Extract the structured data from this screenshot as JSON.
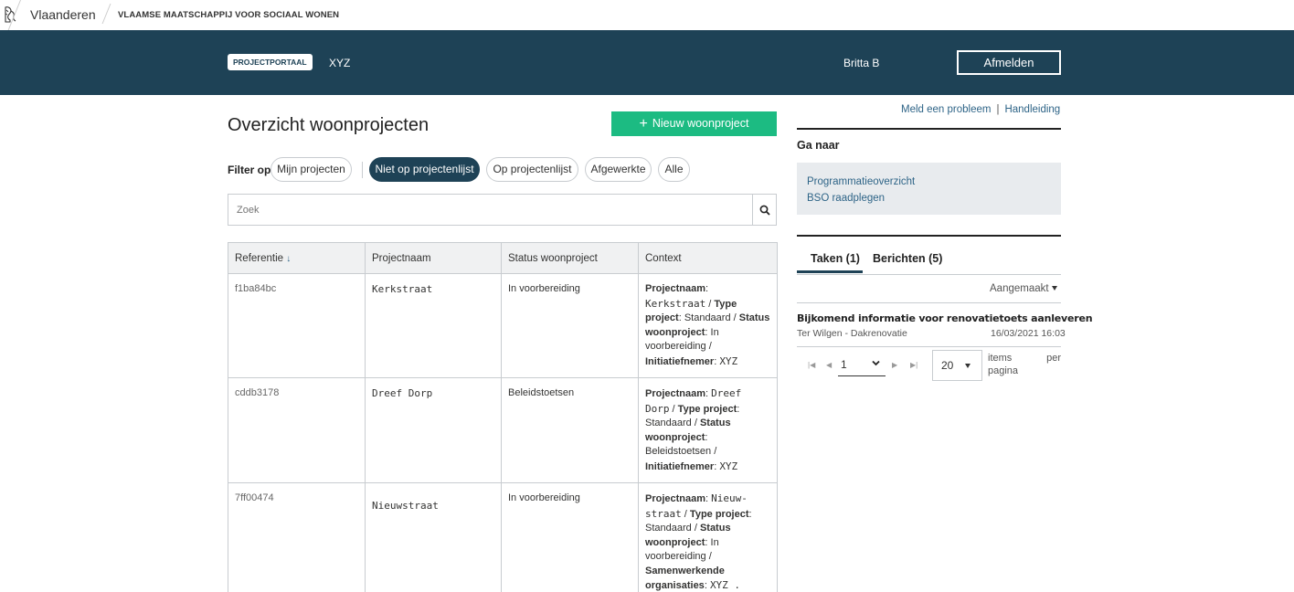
{
  "global_header": {
    "brand": "Vlaanderen",
    "organisation": "VLAAMSE MAATSCHAPPIJ VOOR SOCIAAL WONEN"
  },
  "app_header": {
    "badge": "PROJECTPORTAAL",
    "app_name": "XYZ",
    "user": "Britta B",
    "logout_label": "Afmelden"
  },
  "main": {
    "title": "Overzicht woonprojecten",
    "new_button_label": "Nieuw woonproject",
    "filter_label": "Filter op",
    "filters": [
      {
        "label": "Mijn projecten",
        "active": false
      },
      {
        "label": "Niet op projectenlijst",
        "active": true
      },
      {
        "label": "Op projectenlijst",
        "active": false
      },
      {
        "label": "Afgewerkte",
        "active": false
      },
      {
        "label": "Alle",
        "active": false
      }
    ],
    "search_placeholder": "Zoek",
    "table": {
      "headers": [
        "Referentie",
        "Projectnaam",
        "Status woonproject",
        "Context"
      ],
      "sort_indicator": "↓",
      "rows": [
        {
          "ref": "f1ba84bc",
          "name": "Kerkstraat",
          "status": "In voorbereiding",
          "context": [
            {
              "label": "Projectnaam",
              "value": "Kerkstraat",
              "mono": true
            },
            {
              "label": "Type project",
              "value": "Standaard"
            },
            {
              "label": "Status woonproject",
              "value": "In voorbereiding"
            },
            {
              "label": "Initiatiefnemer",
              "value": "XYZ",
              "mono": true
            }
          ]
        },
        {
          "ref": "cddb3178",
          "name": "Dreef Dorp",
          "status": "Beleidstoetsen",
          "context": [
            {
              "label": "Projectnaam",
              "value": "Dreef Dorp",
              "mono": true
            },
            {
              "label": "Type project",
              "value": "Standaard"
            },
            {
              "label": "Status woonproject",
              "value": "Beleidstoetsen"
            },
            {
              "label": "Initiatiefnemer",
              "value": "XYZ",
              "mono": true
            }
          ]
        },
        {
          "ref": "7ff00474",
          "name": "Nieuwstraat",
          "status": "In voorbereiding",
          "context": [
            {
              "label": "Projectnaam",
              "value": "Nieuw-straat",
              "mono": true
            },
            {
              "label": "Type project",
              "value": "Standaard"
            },
            {
              "label": "Status woonproject",
              "value": "In voorbereiding"
            },
            {
              "label": "Samenwerkende organisaties",
              "value": "XYZ .",
              "mono": true
            }
          ]
        }
      ]
    }
  },
  "sidebar": {
    "links": [
      "Meld een probleem",
      "Handleiding"
    ],
    "link_separator": "|",
    "goto_title": "Ga naar",
    "goto_links": [
      "Programmatieoverzicht",
      "BSO raadplegen"
    ],
    "tabs": [
      {
        "label": "Taken (1)",
        "active": true
      },
      {
        "label": "Berichten (5)",
        "active": false
      }
    ],
    "sort_label": "Aangemaakt",
    "task": {
      "title": "Bijkomend informatie voor renovatietoets aanleveren",
      "subtitle": "Ter Wilgen - Dakrenovatie",
      "date": "16/03/2021 16:03"
    },
    "pagination": {
      "page": "1",
      "per_page": "20",
      "items_label": "items per",
      "pagina_label": "pagina"
    }
  }
}
